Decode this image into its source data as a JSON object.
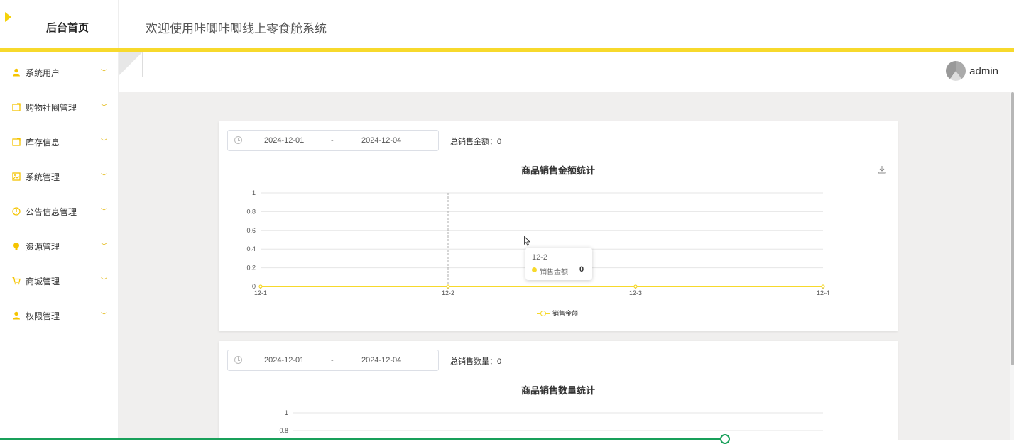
{
  "header": {
    "brand": "后台首页",
    "welcome": "欢迎使用咔唧咔唧线上零食舱系统"
  },
  "user": {
    "name": "admin"
  },
  "sidebar": {
    "items": [
      {
        "label": "系统用户",
        "icon": "user-icon"
      },
      {
        "label": "购物社圈管理",
        "icon": "share-icon"
      },
      {
        "label": "库存信息",
        "icon": "share-icon"
      },
      {
        "label": "系统管理",
        "icon": "image-icon"
      },
      {
        "label": "公告信息管理",
        "icon": "info-circle-icon"
      },
      {
        "label": "资源管理",
        "icon": "bulb-icon"
      },
      {
        "label": "商城管理",
        "icon": "cart-icon"
      },
      {
        "label": "权限管理",
        "icon": "user-icon"
      }
    ]
  },
  "cards": [
    {
      "date_start": "2024-12-01",
      "date_sep": "-",
      "date_end": "2024-12-04",
      "total_label": "总销售金额：0",
      "title": "商品销售金额统计"
    },
    {
      "date_start": "2024-12-01",
      "date_sep": "-",
      "date_end": "2024-12-04",
      "total_label": "总销售数量：0",
      "title": "商品销售数量统计"
    }
  ],
  "tooltip": {
    "title": "12-2",
    "series": "销售金额",
    "value": "0"
  },
  "colors": {
    "accent": "#f7d92c",
    "progress": "#19a05a"
  },
  "chart_data": [
    {
      "type": "line",
      "title": "商品销售金额统计",
      "x": [
        "12-1",
        "12-2",
        "12-3",
        "12-4"
      ],
      "series": [
        {
          "name": "销售金额",
          "values": [
            0,
            0,
            0,
            0
          ]
        }
      ],
      "yticks": [
        "0",
        "0.2",
        "0.4",
        "0.6",
        "0.8",
        "1"
      ],
      "ylim": [
        0,
        1
      ],
      "grid": true,
      "legend": "bottom-center"
    },
    {
      "type": "line",
      "title": "商品销售数量统计",
      "yticks": [
        "0.8",
        "1"
      ],
      "ylim": [
        0,
        1
      ],
      "grid": true
    }
  ]
}
